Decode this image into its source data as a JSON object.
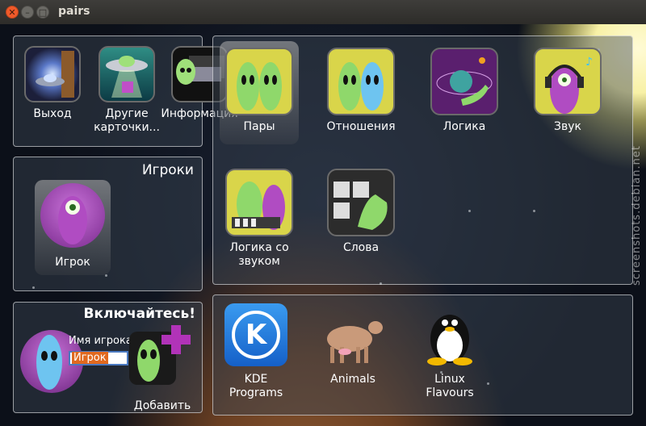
{
  "window": {
    "title": "pairs"
  },
  "menu_panel": {
    "items": [
      {
        "label": "Выход",
        "icon": "door-portal-icon"
      },
      {
        "label": "Другие карточки...",
        "icon": "ufo-icon"
      },
      {
        "label": "Информация",
        "icon": "alien-laptop-icon"
      }
    ]
  },
  "players_panel": {
    "title": "Игроки",
    "players": [
      {
        "label": "Игрок",
        "icon": "purple-alien-icon"
      }
    ]
  },
  "join_panel": {
    "title": "Включайтесь!",
    "name_label": "Имя игрока:",
    "name_value": "Игрок",
    "add_label": "Добавить"
  },
  "games_panel": {
    "games": [
      {
        "label": "Пары",
        "icon": "green-aliens-pair-icon",
        "selected": true
      },
      {
        "label": "Отношения",
        "icon": "green-blue-aliens-icon"
      },
      {
        "label": "Логика",
        "icon": "planet-hand-icon"
      },
      {
        "label": "Звук",
        "icon": "headphones-alien-icon"
      },
      {
        "label": "Логика со звуком",
        "icon": "aliens-keyboard-icon"
      },
      {
        "label": "Слова",
        "icon": "word-cards-hand-icon"
      }
    ]
  },
  "themes_panel": {
    "themes": [
      {
        "label": "KDE Programs",
        "icon": "kde-logo-icon"
      },
      {
        "label": "Animals",
        "icon": "cow-icon"
      },
      {
        "label": "Linux Flavours",
        "icon": "tux-penguin-icon"
      }
    ]
  },
  "watermark": "screenshots.debian.net",
  "colors": {
    "accent": "#e0691f",
    "close": "#ef5a2a"
  }
}
